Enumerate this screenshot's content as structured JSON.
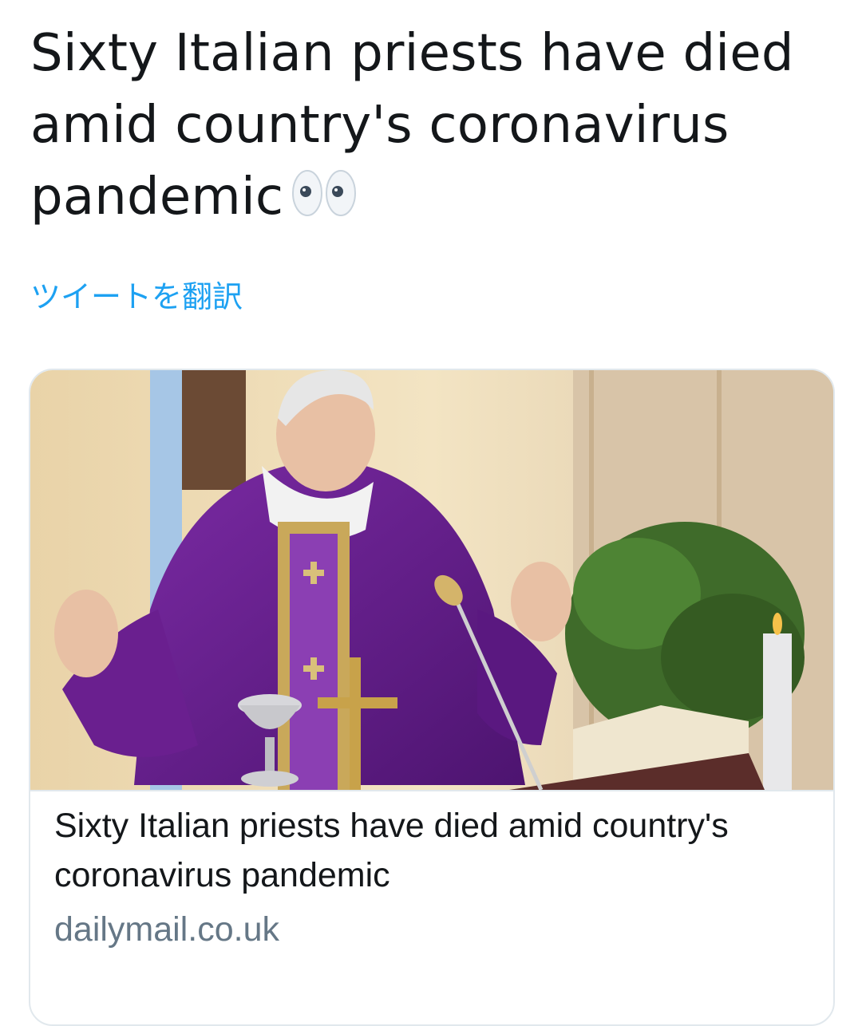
{
  "tweet": {
    "text": "Sixty Italian priests have died amid country's coronavirus pandemic",
    "emoji": "eyes-icon",
    "translate_label": "ツイートを翻訳"
  },
  "card": {
    "title": "Sixty Italian priests have died amid country's coronavirus pandemic",
    "domain": "dailymail.co.uk"
  },
  "colors": {
    "text": "#14171a",
    "link": "#1da1f2",
    "muted": "#657786",
    "border": "#e1e8ed",
    "vestment": "#6a1f8f"
  }
}
